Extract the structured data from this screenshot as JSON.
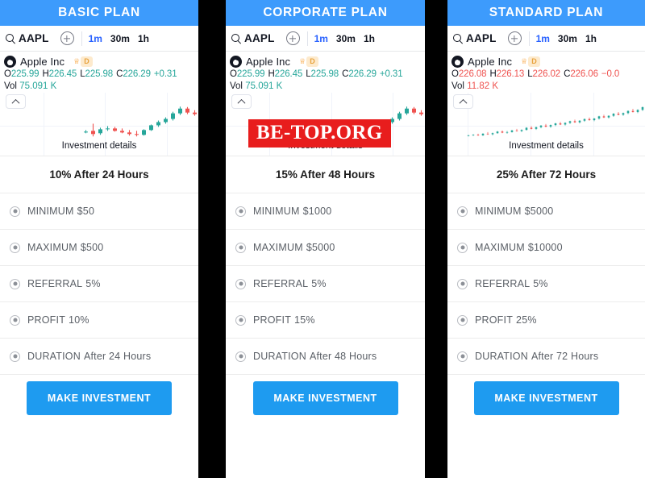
{
  "watermark": {
    "text": "BE-TOP.ORG",
    "bg": "#e81d1d",
    "fg": "#ffffff"
  },
  "colors": {
    "header_blue": "#3d9bfc",
    "cta_blue": "#1e9bf0",
    "up_green": "#26a69a",
    "down_red": "#ef5350",
    "active_interval": "#2962ff"
  },
  "panels": [
    {
      "header_title": "BASIC PLAN",
      "toolbar": {
        "search_icon": "search-icon",
        "symbol": "AAPL",
        "add_icon": "plus-circle-icon",
        "intervals": [
          {
            "label": "1m",
            "active": true
          },
          {
            "label": "30m",
            "active": false
          },
          {
            "label": "1h",
            "active": false
          }
        ]
      },
      "legend": {
        "logo": "apple-logo-icon",
        "name": "Apple Inc",
        "crown_icon": "crown-icon",
        "badge": "D",
        "o_label": "O",
        "o_value": "225.99",
        "h_label": "H",
        "h_value": "226.45",
        "l_label": "L",
        "l_value": "225.98",
        "c_label": "C",
        "c_value": "226.29",
        "change": "+0.31",
        "direction": "up",
        "vol_label": "Vol",
        "vol_value": "75.091 K"
      },
      "chart": {
        "caption": "Investment details",
        "collapse_icon": "chevron-up-icon"
      },
      "rate_title": "10% After 24 Hours",
      "details": [
        {
          "key": "MINIMUM",
          "value": "$50"
        },
        {
          "key": "MAXIMUM",
          "value": "$500"
        },
        {
          "key": "REFERRAL",
          "value": "5%"
        },
        {
          "key": "PROFIT",
          "value": "10%"
        },
        {
          "key": "DURATION",
          "value": "After 24 Hours"
        }
      ],
      "cta_label": "MAKE INVESTMENT"
    },
    {
      "header_title": "CORPORATE PLAN",
      "toolbar": {
        "search_icon": "search-icon",
        "symbol": "AAPL",
        "add_icon": "plus-circle-icon",
        "intervals": [
          {
            "label": "1m",
            "active": true
          },
          {
            "label": "30m",
            "active": false
          },
          {
            "label": "1h",
            "active": false
          }
        ]
      },
      "legend": {
        "logo": "apple-logo-icon",
        "name": "Apple Inc",
        "crown_icon": "crown-icon",
        "badge": "D",
        "o_label": "O",
        "o_value": "225.99",
        "h_label": "H",
        "h_value": "226.45",
        "l_label": "L",
        "l_value": "225.98",
        "c_label": "C",
        "c_value": "226.29",
        "change": "+0.31",
        "direction": "up",
        "vol_label": "Vol",
        "vol_value": "75.091 K"
      },
      "chart": {
        "caption": "Investment details",
        "collapse_icon": "chevron-up-icon"
      },
      "rate_title": "15% After 48 Hours",
      "details": [
        {
          "key": "MINIMUM",
          "value": "$1000"
        },
        {
          "key": "MAXIMUM",
          "value": "$5000"
        },
        {
          "key": "REFERRAL",
          "value": "5%"
        },
        {
          "key": "PROFIT",
          "value": "15%"
        },
        {
          "key": "DURATION",
          "value": "After 48 Hours"
        }
      ],
      "cta_label": "MAKE INVESTMENT"
    },
    {
      "header_title": "STANDARD PLAN",
      "toolbar": {
        "search_icon": "search-icon",
        "symbol": "AAPL",
        "add_icon": "plus-circle-icon",
        "intervals": [
          {
            "label": "1m",
            "active": true
          },
          {
            "label": "30m",
            "active": false
          },
          {
            "label": "1h",
            "active": false
          }
        ]
      },
      "legend": {
        "logo": "apple-logo-icon",
        "name": "Apple Inc",
        "crown_icon": "crown-icon",
        "badge": "D",
        "o_label": "O",
        "o_value": "226.08",
        "h_label": "H",
        "h_value": "226.13",
        "l_label": "L",
        "l_value": "226.02",
        "c_label": "C",
        "c_value": "226.06",
        "change": "−0.0",
        "direction": "down",
        "vol_label": "Vol",
        "vol_value": "11.82 K"
      },
      "chart": {
        "caption": "Investment details",
        "collapse_icon": "chevron-up-icon"
      },
      "rate_title": "25% After 72 Hours",
      "details": [
        {
          "key": "MINIMUM",
          "value": "$5000"
        },
        {
          "key": "MAXIMUM",
          "value": "$10000"
        },
        {
          "key": "REFERRAL",
          "value": "5%"
        },
        {
          "key": "PROFIT",
          "value": "25%"
        },
        {
          "key": "DURATION",
          "value": "After 72 Hours"
        }
      ],
      "cta_label": "MAKE INVESTMENT"
    }
  ],
  "chart_data": [
    {
      "type": "candlestick",
      "title": "Investment details",
      "panel": "BASIC PLAN",
      "symbol": "AAPL",
      "interval": "1m",
      "candles": [
        {
          "o": 225.8,
          "h": 225.86,
          "l": 225.78,
          "c": 225.82,
          "dir": "up"
        },
        {
          "o": 225.84,
          "h": 226.02,
          "l": 225.7,
          "c": 225.76,
          "dir": "down"
        },
        {
          "o": 225.78,
          "h": 225.92,
          "l": 225.74,
          "c": 225.88,
          "dir": "up"
        },
        {
          "o": 225.88,
          "h": 225.96,
          "l": 225.84,
          "c": 225.9,
          "dir": "up"
        },
        {
          "o": 225.9,
          "h": 225.94,
          "l": 225.82,
          "c": 225.84,
          "dir": "down"
        },
        {
          "o": 225.84,
          "h": 225.9,
          "l": 225.78,
          "c": 225.8,
          "dir": "down"
        },
        {
          "o": 225.8,
          "h": 225.86,
          "l": 225.72,
          "c": 225.76,
          "dir": "down"
        },
        {
          "o": 225.76,
          "h": 225.84,
          "l": 225.7,
          "c": 225.74,
          "dir": "down"
        },
        {
          "o": 225.74,
          "h": 225.88,
          "l": 225.72,
          "c": 225.86,
          "dir": "up"
        },
        {
          "o": 225.86,
          "h": 226.0,
          "l": 225.84,
          "c": 225.98,
          "dir": "up"
        },
        {
          "o": 225.98,
          "h": 226.1,
          "l": 225.94,
          "c": 226.06,
          "dir": "up"
        },
        {
          "o": 226.06,
          "h": 226.18,
          "l": 226.02,
          "c": 226.14,
          "dir": "up"
        },
        {
          "o": 226.14,
          "h": 226.32,
          "l": 226.1,
          "c": 226.28,
          "dir": "up"
        },
        {
          "o": 226.28,
          "h": 226.45,
          "l": 226.24,
          "c": 226.4,
          "dir": "up"
        },
        {
          "o": 226.4,
          "h": 226.44,
          "l": 226.26,
          "c": 226.3,
          "dir": "down"
        },
        {
          "o": 226.3,
          "h": 226.36,
          "l": 226.22,
          "c": 226.26,
          "dir": "down"
        }
      ],
      "grid": true,
      "xlabel": "",
      "ylabel": ""
    },
    {
      "type": "candlestick",
      "title": "Investment details",
      "panel": "CORPORATE PLAN",
      "symbol": "AAPL",
      "interval": "1m",
      "candles": [
        {
          "o": 225.8,
          "h": 225.86,
          "l": 225.78,
          "c": 225.82,
          "dir": "up"
        },
        {
          "o": 225.84,
          "h": 226.02,
          "l": 225.7,
          "c": 225.76,
          "dir": "down"
        },
        {
          "o": 225.78,
          "h": 225.92,
          "l": 225.74,
          "c": 225.88,
          "dir": "up"
        },
        {
          "o": 225.88,
          "h": 225.96,
          "l": 225.84,
          "c": 225.9,
          "dir": "up"
        },
        {
          "o": 225.9,
          "h": 225.94,
          "l": 225.82,
          "c": 225.84,
          "dir": "down"
        },
        {
          "o": 225.84,
          "h": 225.9,
          "l": 225.78,
          "c": 225.8,
          "dir": "down"
        },
        {
          "o": 225.8,
          "h": 225.86,
          "l": 225.72,
          "c": 225.76,
          "dir": "down"
        },
        {
          "o": 225.76,
          "h": 225.84,
          "l": 225.7,
          "c": 225.74,
          "dir": "down"
        },
        {
          "o": 225.74,
          "h": 225.88,
          "l": 225.72,
          "c": 225.86,
          "dir": "up"
        },
        {
          "o": 225.86,
          "h": 226.0,
          "l": 225.84,
          "c": 225.98,
          "dir": "up"
        },
        {
          "o": 225.98,
          "h": 226.1,
          "l": 225.94,
          "c": 226.06,
          "dir": "up"
        },
        {
          "o": 226.06,
          "h": 226.18,
          "l": 226.02,
          "c": 226.14,
          "dir": "up"
        },
        {
          "o": 226.14,
          "h": 226.32,
          "l": 226.1,
          "c": 226.28,
          "dir": "up"
        },
        {
          "o": 226.28,
          "h": 226.45,
          "l": 226.24,
          "c": 226.4,
          "dir": "up"
        },
        {
          "o": 226.4,
          "h": 226.44,
          "l": 226.26,
          "c": 226.3,
          "dir": "down"
        },
        {
          "o": 226.3,
          "h": 226.36,
          "l": 226.22,
          "c": 226.26,
          "dir": "down"
        }
      ],
      "grid": true,
      "xlabel": "",
      "ylabel": ""
    },
    {
      "type": "candlestick",
      "title": "Investment details",
      "panel": "STANDARD PLAN",
      "symbol": "AAPL",
      "interval": "1m",
      "candles": [
        {
          "o": 225.86,
          "h": 225.88,
          "l": 225.85,
          "c": 225.87,
          "dir": "up"
        },
        {
          "o": 225.87,
          "h": 225.89,
          "l": 225.86,
          "c": 225.88,
          "dir": "up"
        },
        {
          "o": 225.88,
          "h": 225.9,
          "l": 225.86,
          "c": 225.87,
          "dir": "down"
        },
        {
          "o": 225.87,
          "h": 225.91,
          "l": 225.86,
          "c": 225.9,
          "dir": "up"
        },
        {
          "o": 225.9,
          "h": 225.93,
          "l": 225.88,
          "c": 225.89,
          "dir": "down"
        },
        {
          "o": 225.89,
          "h": 225.92,
          "l": 225.87,
          "c": 225.91,
          "dir": "up"
        },
        {
          "o": 225.91,
          "h": 225.95,
          "l": 225.9,
          "c": 225.94,
          "dir": "up"
        },
        {
          "o": 225.94,
          "h": 225.96,
          "l": 225.91,
          "c": 225.92,
          "dir": "down"
        },
        {
          "o": 225.92,
          "h": 225.95,
          "l": 225.9,
          "c": 225.93,
          "dir": "up"
        },
        {
          "o": 225.93,
          "h": 225.97,
          "l": 225.92,
          "c": 225.96,
          "dir": "up"
        },
        {
          "o": 225.96,
          "h": 225.99,
          "l": 225.94,
          "c": 225.95,
          "dir": "down"
        },
        {
          "o": 225.95,
          "h": 225.98,
          "l": 225.93,
          "c": 225.97,
          "dir": "up"
        },
        {
          "o": 225.97,
          "h": 226.02,
          "l": 225.96,
          "c": 226.01,
          "dir": "up"
        },
        {
          "o": 226.01,
          "h": 226.04,
          "l": 225.98,
          "c": 225.99,
          "dir": "down"
        },
        {
          "o": 225.99,
          "h": 226.03,
          "l": 225.97,
          "c": 226.02,
          "dir": "up"
        },
        {
          "o": 226.02,
          "h": 226.06,
          "l": 226.0,
          "c": 226.05,
          "dir": "up"
        },
        {
          "o": 226.05,
          "h": 226.08,
          "l": 226.02,
          "c": 226.03,
          "dir": "down"
        },
        {
          "o": 226.03,
          "h": 226.07,
          "l": 226.01,
          "c": 226.06,
          "dir": "up"
        },
        {
          "o": 226.06,
          "h": 226.1,
          "l": 226.04,
          "c": 226.09,
          "dir": "up"
        },
        {
          "o": 226.09,
          "h": 226.12,
          "l": 226.06,
          "c": 226.07,
          "dir": "down"
        },
        {
          "o": 226.07,
          "h": 226.11,
          "l": 226.05,
          "c": 226.1,
          "dir": "up"
        },
        {
          "o": 226.1,
          "h": 226.14,
          "l": 226.08,
          "c": 226.13,
          "dir": "up"
        },
        {
          "o": 226.13,
          "h": 226.16,
          "l": 226.1,
          "c": 226.11,
          "dir": "down"
        },
        {
          "o": 226.11,
          "h": 226.15,
          "l": 226.09,
          "c": 226.14,
          "dir": "up"
        },
        {
          "o": 226.14,
          "h": 226.18,
          "l": 226.12,
          "c": 226.17,
          "dir": "up"
        },
        {
          "o": 226.17,
          "h": 226.2,
          "l": 226.14,
          "c": 226.15,
          "dir": "down"
        },
        {
          "o": 226.15,
          "h": 226.19,
          "l": 226.13,
          "c": 226.18,
          "dir": "up"
        },
        {
          "o": 226.18,
          "h": 226.23,
          "l": 226.16,
          "c": 226.22,
          "dir": "up"
        },
        {
          "o": 226.22,
          "h": 226.25,
          "l": 226.19,
          "c": 226.2,
          "dir": "down"
        },
        {
          "o": 226.2,
          "h": 226.24,
          "l": 226.18,
          "c": 226.23,
          "dir": "up"
        },
        {
          "o": 226.23,
          "h": 226.28,
          "l": 226.21,
          "c": 226.27,
          "dir": "up"
        },
        {
          "o": 226.27,
          "h": 226.3,
          "l": 226.24,
          "c": 226.25,
          "dir": "down"
        },
        {
          "o": 226.25,
          "h": 226.29,
          "l": 226.23,
          "c": 226.28,
          "dir": "up"
        },
        {
          "o": 226.28,
          "h": 226.33,
          "l": 226.26,
          "c": 226.32,
          "dir": "up"
        },
        {
          "o": 226.32,
          "h": 226.36,
          "l": 226.29,
          "c": 226.3,
          "dir": "down"
        },
        {
          "o": 226.3,
          "h": 226.35,
          "l": 226.28,
          "c": 226.34,
          "dir": "up"
        },
        {
          "o": 226.34,
          "h": 226.4,
          "l": 226.32,
          "c": 226.39,
          "dir": "up"
        }
      ],
      "grid": true,
      "xlabel": "",
      "ylabel": ""
    }
  ]
}
